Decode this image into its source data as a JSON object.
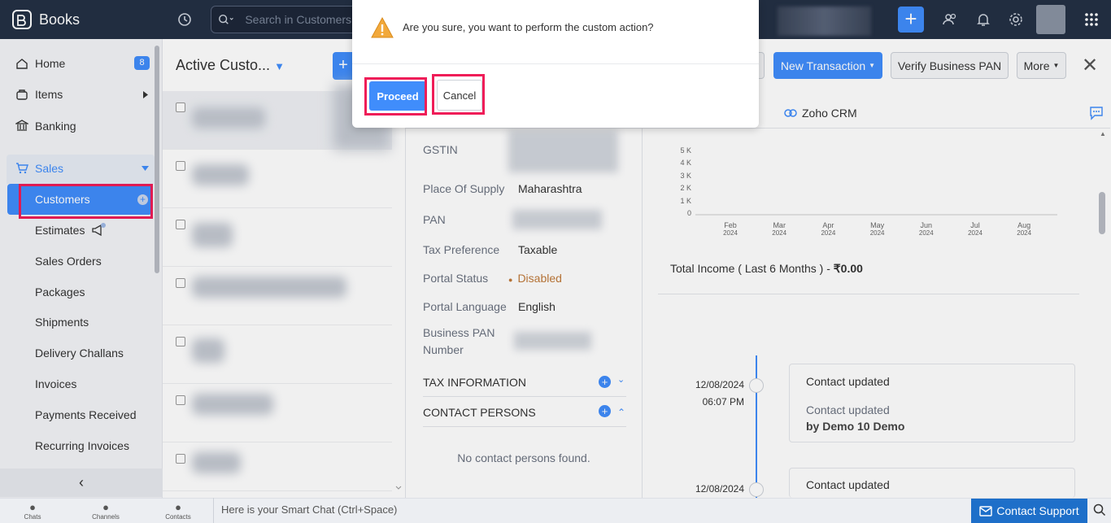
{
  "app": {
    "name": "Books",
    "search_placeholder": "Search in Customers ( / )"
  },
  "sidebar": {
    "home": "Home",
    "home_badge": "8",
    "items": "Items",
    "banking": "Banking",
    "sales": "Sales",
    "sub": [
      "Customers",
      "Estimates",
      "Sales Orders",
      "Packages",
      "Shipments",
      "Delivery Challans",
      "Invoices",
      "Payments Received",
      "Recurring Invoices"
    ]
  },
  "list": {
    "title": "Active Custo..."
  },
  "toolbar": {
    "new_transaction": "New Transaction",
    "verify_pan": "Verify Business PAN",
    "more": "More"
  },
  "tabs": {
    "zoho_crm": "Zoho CRM"
  },
  "details": {
    "gstin": "GSTIN",
    "place_of_supply": "Place Of Supply",
    "place_of_supply_value": "Maharashtra",
    "pan": "PAN",
    "tax_preference": "Tax Preference",
    "tax_preference_value": "Taxable",
    "portal_status": "Portal Status",
    "portal_status_value": "Disabled",
    "portal_language": "Portal Language",
    "portal_language_value": "English",
    "business_pan_1": "Business PAN",
    "business_pan_2": "Number"
  },
  "sections": {
    "tax_info": "TAX INFORMATION",
    "contact_persons": "CONTACT PERSONS",
    "no_contacts": "No contact persons found."
  },
  "chart_data": {
    "type": "line",
    "categories": [
      "Feb 2024",
      "Mar 2024",
      "Apr 2024",
      "May 2024",
      "Jun 2024",
      "Jul 2024",
      "Aug 2024"
    ],
    "x_months": [
      "Feb",
      "Mar",
      "Apr",
      "May",
      "Jun",
      "Jul",
      "Aug"
    ],
    "x_years": [
      "2024",
      "2024",
      "2024",
      "2024",
      "2024",
      "2024",
      "2024"
    ],
    "y_ticks": [
      "5 K",
      "4 K",
      "3 K",
      "2 K",
      "1 K",
      "0"
    ],
    "values": [
      0,
      0,
      0,
      0,
      0,
      0,
      0
    ],
    "ylim": [
      0,
      5000
    ]
  },
  "income": {
    "label": "Total Income ( Last 6 Months ) - ",
    "value": "₹0.00"
  },
  "timeline": [
    {
      "date": "12/08/2024",
      "time": "06:07 PM",
      "title": "Contact updated",
      "desc": "Contact updated",
      "by": "by Demo 10 Demo"
    },
    {
      "date": "12/08/2024",
      "title": "Contact updated"
    }
  ],
  "bottom": {
    "chats": "Chats",
    "channels": "Channels",
    "contacts": "Contacts",
    "smart_chat": "Here is your Smart Chat (Ctrl+Space)",
    "support": "Contact Support"
  },
  "modal": {
    "message": "Are you sure, you want to perform the custom action?",
    "proceed": "Proceed",
    "cancel": "Cancel"
  },
  "colors": {
    "accent": "#408dfb",
    "highlight": "#ef1d58",
    "topbar": "#243045",
    "disabled": "#c07a3a"
  }
}
